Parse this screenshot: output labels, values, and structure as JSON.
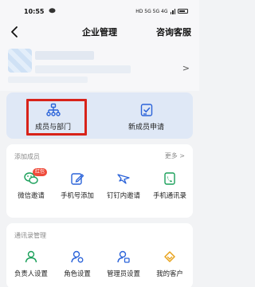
{
  "status_bar": {
    "time": "10:55",
    "indicators": "HD 5G 5G 4G",
    "battery": "72"
  },
  "nav": {
    "title": "企业管理",
    "consult": "咨询客服",
    "back_icon": "back-arrow-icon"
  },
  "dept_card": {
    "items": [
      {
        "label": "成员与部门",
        "icon": "org-structure-icon"
      },
      {
        "label": "新成员申请",
        "icon": "user-apply-icon"
      }
    ],
    "highlight_color": "#d8231a"
  },
  "add_members": {
    "title": "添加成员",
    "more": "更多 >",
    "items": [
      {
        "label": "微信邀请",
        "badge": "红包",
        "icon": "wechat-icon"
      },
      {
        "label": "手机号添加",
        "icon": "edit-icon"
      },
      {
        "label": "钉钉内邀请",
        "icon": "dingtalk-icon"
      },
      {
        "label": "手机通讯录",
        "icon": "phone-book-icon"
      }
    ]
  },
  "contacts_mgmt": {
    "title": "通讯录管理",
    "items": [
      {
        "label": "负责人设置",
        "icon": "person-star-icon"
      },
      {
        "label": "角色设置",
        "icon": "role-icon"
      },
      {
        "label": "管理员设置",
        "icon": "admin-icon"
      },
      {
        "label": "我的客户",
        "icon": "customer-icon"
      }
    ]
  },
  "colors": {
    "accent_blue": "#2b63d9",
    "accent_green": "#1aa05a",
    "accent_gold": "#e8a21a"
  }
}
